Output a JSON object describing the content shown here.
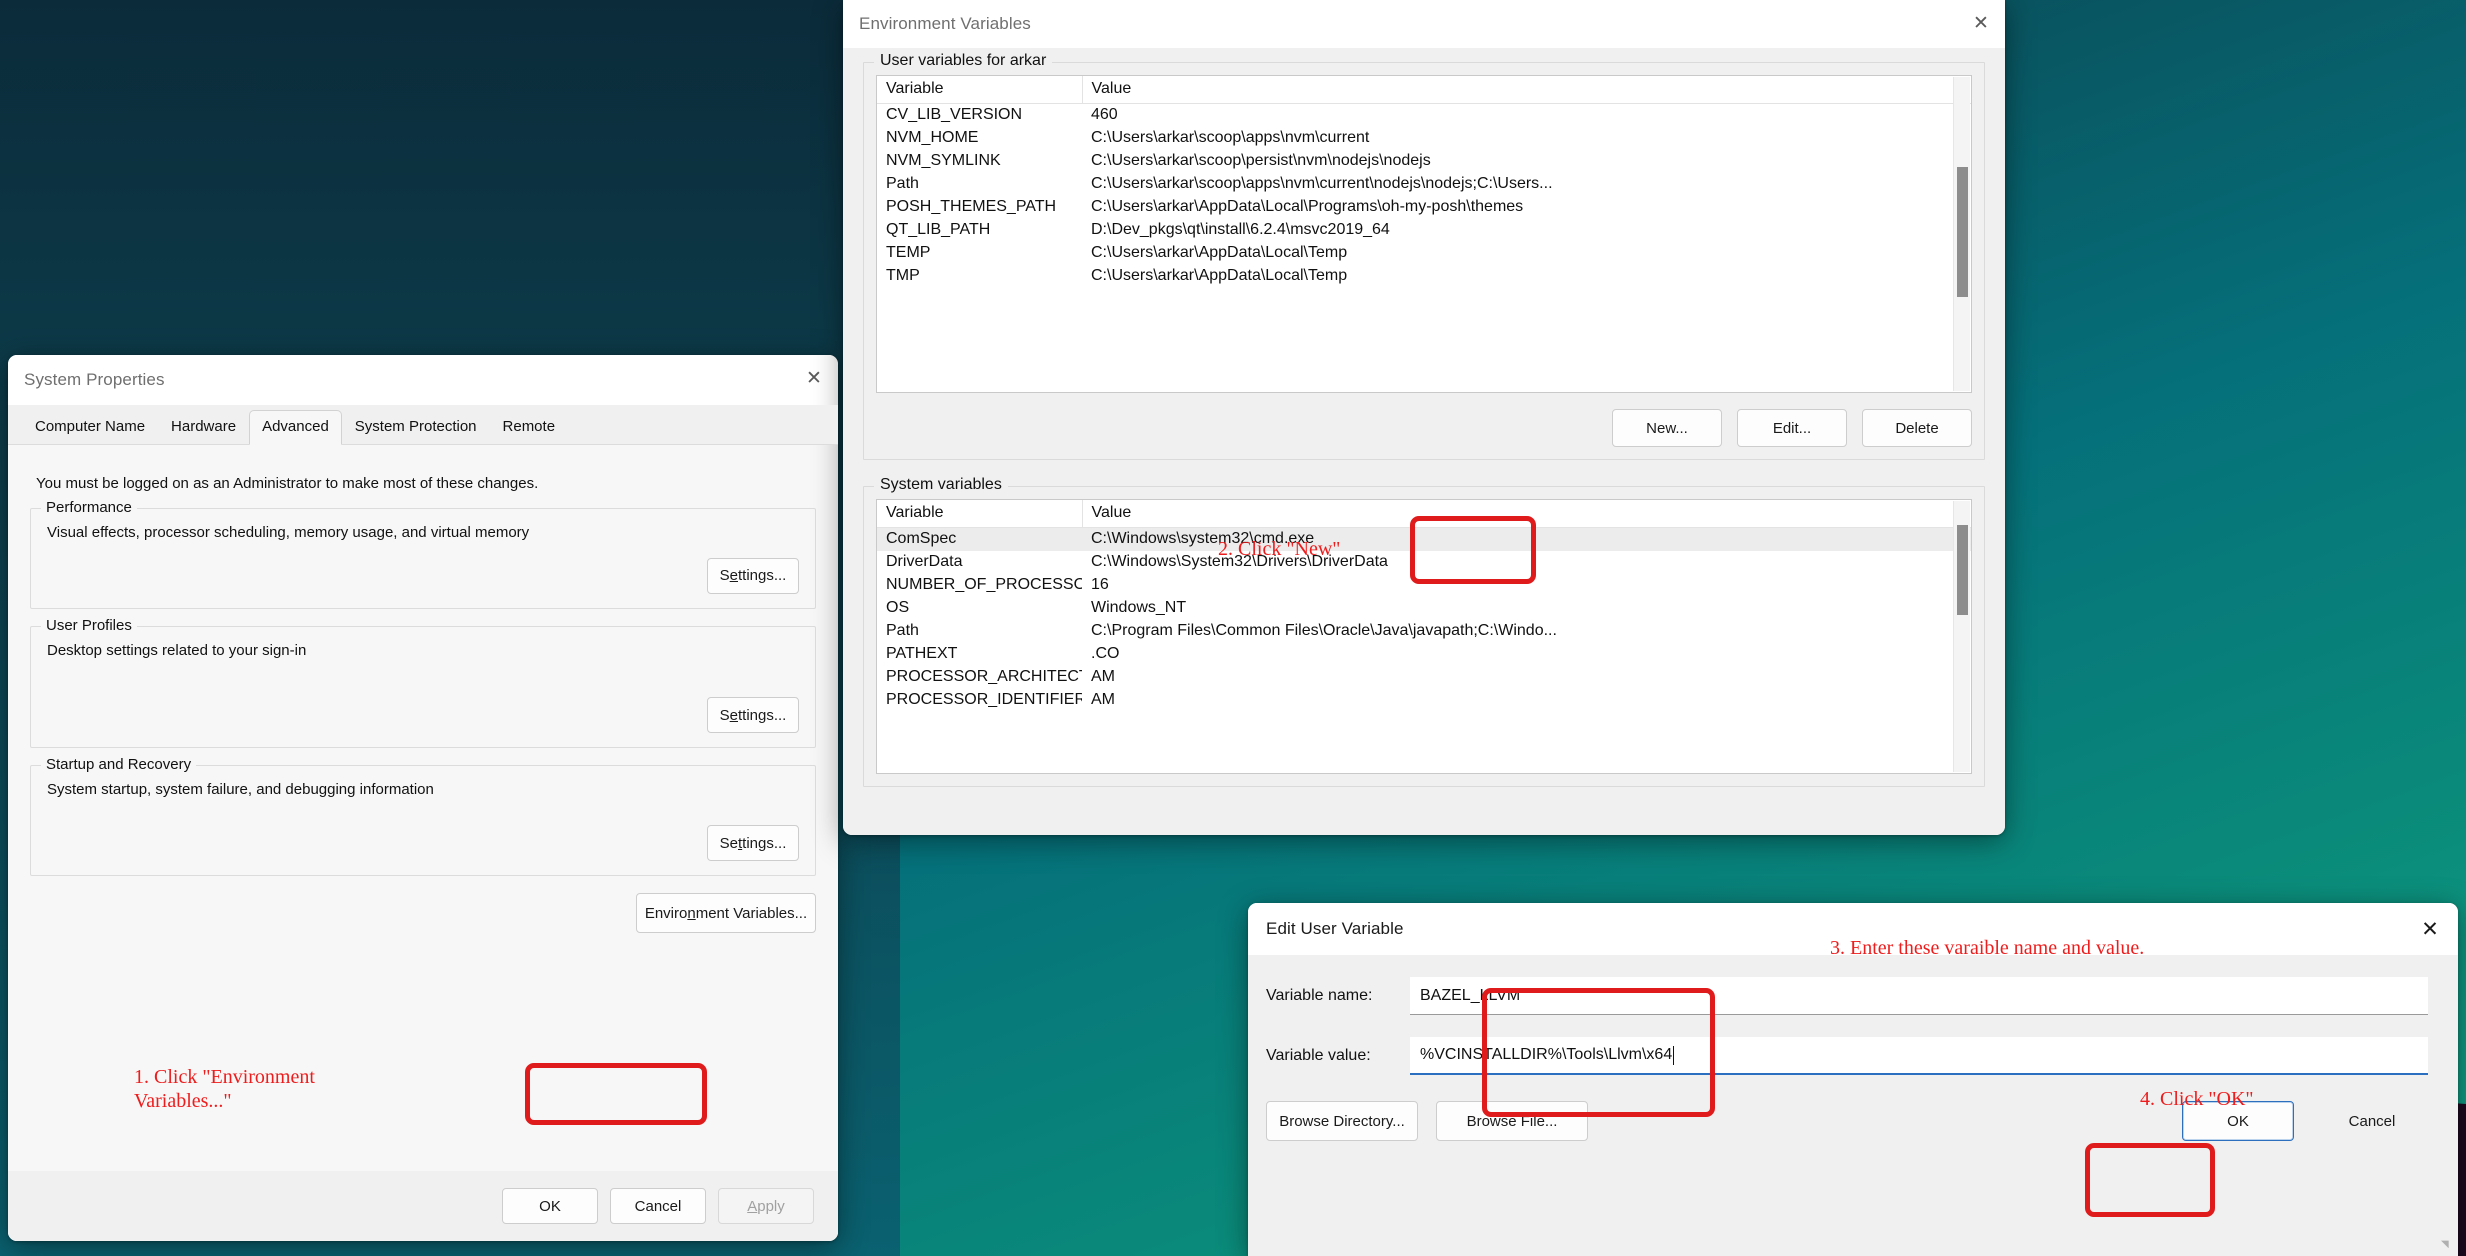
{
  "desktop": {
    "wallpaper_top_color": "#0a3442",
    "wallpaper_mid_color": "#05707a",
    "wallpaper_bottom_color": "#12a587",
    "mountain_color": "#1c0a20"
  },
  "annotation_color": "#ee1c1c",
  "annotations": {
    "step1": "1. Click \"Environment\nVariables...\"",
    "step2": "2. Click \"New\"",
    "step3": "3. Enter these varaible name and value.",
    "step4": "4. Click \"OK\""
  },
  "system_properties": {
    "title": "System Properties",
    "close_icon": "close-icon",
    "tabs": [
      {
        "label": "Computer Name",
        "active": false
      },
      {
        "label": "Hardware",
        "active": false
      },
      {
        "label": "Advanced",
        "active": true
      },
      {
        "label": "System Protection",
        "active": false
      },
      {
        "label": "Remote",
        "active": false
      }
    ],
    "admin_note": "You must be logged on as an Administrator to make most of these changes.",
    "groups": [
      {
        "title": "Performance",
        "description": "Visual effects, processor scheduling, memory usage, and virtual memory",
        "button": "Settings...",
        "button_accel": "e"
      },
      {
        "title": "User Profiles",
        "description": "Desktop settings related to your sign-in",
        "button": "Settings...",
        "button_accel": "e"
      },
      {
        "title": "Startup and Recovery",
        "description": "System startup, system failure, and debugging information",
        "button": "Settings...",
        "button_accel": "t"
      }
    ],
    "env_vars_button": "Environment Variables...",
    "footer": {
      "ok": "OK",
      "cancel": "Cancel",
      "apply": "Apply",
      "apply_disabled": true
    }
  },
  "environment_variables": {
    "title": "Environment Variables",
    "close_icon": "close-icon",
    "user_section": {
      "title": "User variables for arkar",
      "columns": [
        "Variable",
        "Value"
      ],
      "rows": [
        {
          "variable": "CV_LIB_VERSION",
          "value": "460"
        },
        {
          "variable": "NVM_HOME",
          "value": "C:\\Users\\arkar\\scoop\\apps\\nvm\\current"
        },
        {
          "variable": "NVM_SYMLINK",
          "value": "C:\\Users\\arkar\\scoop\\persist\\nvm\\nodejs\\nodejs"
        },
        {
          "variable": "Path",
          "value": "C:\\Users\\arkar\\scoop\\apps\\nvm\\current\\nodejs\\nodejs;C:\\Users..."
        },
        {
          "variable": "POSH_THEMES_PATH",
          "value": "C:\\Users\\arkar\\AppData\\Local\\Programs\\oh-my-posh\\themes"
        },
        {
          "variable": "QT_LIB_PATH",
          "value": "D:\\Dev_pkgs\\qt\\install\\6.2.4\\msvc2019_64"
        },
        {
          "variable": "TEMP",
          "value": "C:\\Users\\arkar\\AppData\\Local\\Temp"
        },
        {
          "variable": "TMP",
          "value": "C:\\Users\\arkar\\AppData\\Local\\Temp"
        }
      ],
      "buttons": {
        "new": "New...",
        "edit": "Edit...",
        "delete": "Delete"
      }
    },
    "system_section": {
      "title": "System variables",
      "columns": [
        "Variable",
        "Value"
      ],
      "rows": [
        {
          "variable": "ComSpec",
          "value": "C:\\Windows\\system32\\cmd.exe",
          "selected": true
        },
        {
          "variable": "DriverData",
          "value": "C:\\Windows\\System32\\Drivers\\DriverData",
          "selected": false
        },
        {
          "variable": "NUMBER_OF_PROCESSORS",
          "value": "16",
          "selected": false
        },
        {
          "variable": "OS",
          "value": "Windows_NT",
          "selected": false
        },
        {
          "variable": "Path",
          "value": "C:\\Program Files\\Common Files\\Oracle\\Java\\javapath;C:\\Windo...",
          "selected": false
        },
        {
          "variable": "PATHEXT",
          "value": ".CO",
          "selected": false
        },
        {
          "variable": "PROCESSOR_ARCHITECTURE",
          "value": "AM",
          "selected": false
        },
        {
          "variable": "PROCESSOR_IDENTIFIER",
          "value": "AM",
          "selected": false
        }
      ]
    }
  },
  "edit_user_variable": {
    "title": "Edit User Variable",
    "close_icon": "close-icon",
    "variable_name_label": "Variable name:",
    "variable_name_value": "BAZEL_LLVM",
    "variable_value_label": "Variable value:",
    "variable_value_value": "%VCINSTALLDIR%\\Tools\\Llvm\\x64",
    "buttons": {
      "browse_directory": "Browse Directory...",
      "browse_file": "Browse File...",
      "ok": "OK",
      "cancel": "Cancel"
    }
  }
}
